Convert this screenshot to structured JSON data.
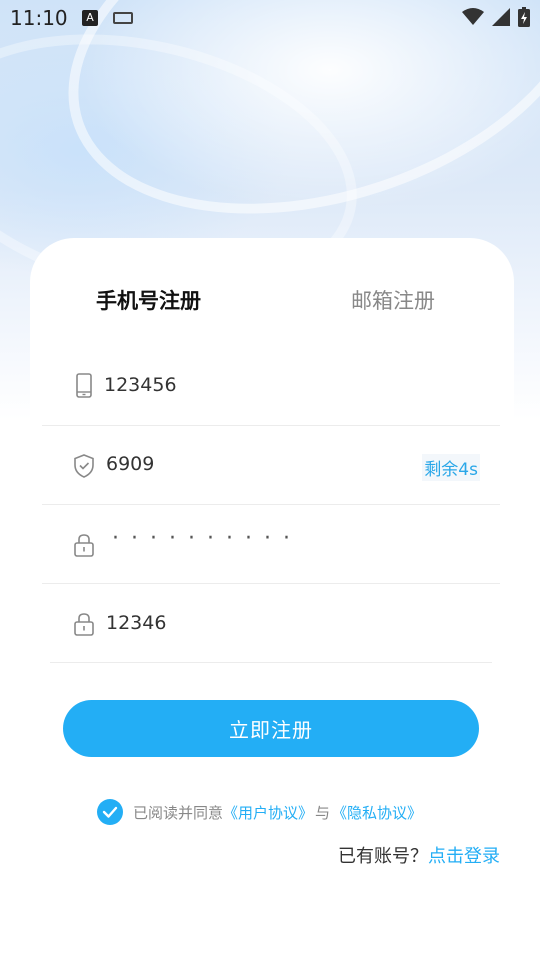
{
  "status_bar": {
    "time": "11:10",
    "a_badge": "A",
    "icons": [
      "wifi-icon",
      "signal-icon",
      "battery-icon"
    ]
  },
  "tabs": {
    "phone": "手机号注册",
    "email": "邮箱注册"
  },
  "form": {
    "phone_value": "123456",
    "code_value": "6909",
    "countdown": "剩余4s",
    "password_masked": "··········",
    "confirm_value": "12346"
  },
  "register_button": "立即注册",
  "agreement": {
    "prefix": "已阅读并同意",
    "user_agreement": "《用户协议》",
    "connector": "与",
    "privacy_agreement": "《隐私协议》"
  },
  "login": {
    "question": "已有账号？",
    "link": "点击登录"
  },
  "colors": {
    "accent": "#23aef5",
    "text": "#333333",
    "muted": "#888888"
  }
}
